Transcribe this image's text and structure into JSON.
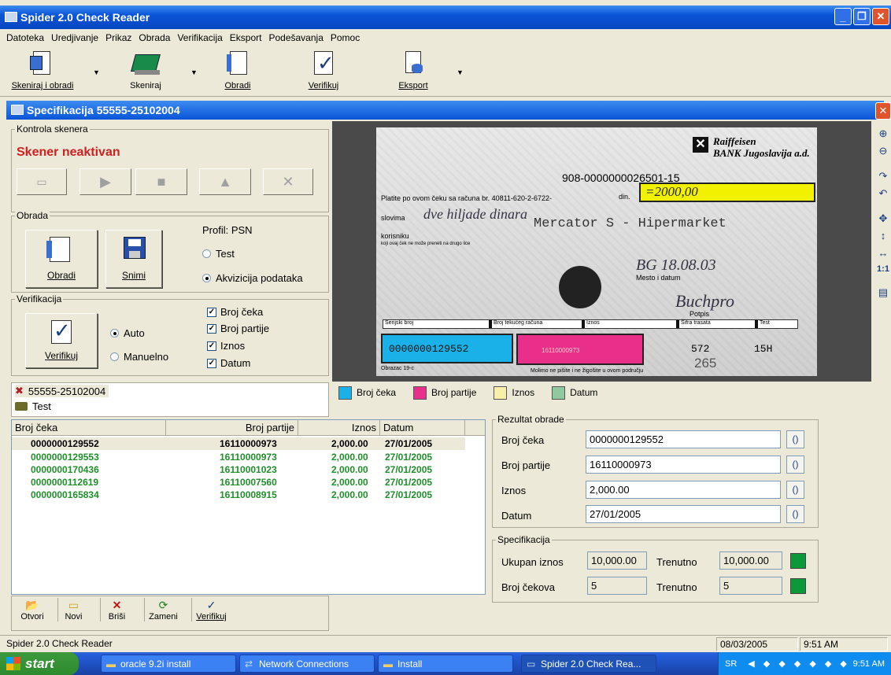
{
  "window": {
    "title": "Spider 2.0 Check Reader",
    "btn_min": "_",
    "btn_max": "❐",
    "btn_close": "✕"
  },
  "menu": [
    "Datoteka",
    "Uredjivanje",
    "Prikaz",
    "Obrada",
    "Verifikacija",
    "Eksport",
    "Podešavanja",
    "Pomoc"
  ],
  "toolbar": {
    "scan_process": "Skeniraj i obradi",
    "scan": "Skeniraj",
    "process": "Obradi",
    "verify": "Verifikuj",
    "export": "Eksport"
  },
  "doc": {
    "title": "Specifikacija 55555-25102004"
  },
  "scanner": {
    "group_label": "Kontrola skenera",
    "status": "Skener neaktivan"
  },
  "processing": {
    "group_label": "Obrada",
    "process_label": "Obradi",
    "save_label": "Snimi",
    "profile": "Profil: PSN",
    "radio_test": "Test",
    "radio_acq": "Akvizicija podataka"
  },
  "verification": {
    "group_label": "Verifikacija",
    "verify_label": "Verifikuj",
    "radio_auto": "Auto",
    "radio_manual": "Manuelno",
    "chk_check_no": "Broj čeka",
    "chk_account": "Broj partije",
    "chk_amount": "Iznos",
    "chk_date": "Datum"
  },
  "tree": {
    "root": "55555-25102004",
    "child": "Test"
  },
  "list": {
    "headers": [
      "Broj čeka",
      "Broj partije",
      "Iznos",
      "Datum"
    ],
    "rows": [
      [
        "0000000129552",
        "16110000973",
        "2,000.00",
        "27/01/2005"
      ],
      [
        "0000000129553",
        "16110000973",
        "2,000.00",
        "27/01/2005"
      ],
      [
        "0000000170436",
        "16110001023",
        "2,000.00",
        "27/01/2005"
      ],
      [
        "0000000112619",
        "16110007560",
        "2,000.00",
        "27/01/2005"
      ],
      [
        "0000000165834",
        "16110008915",
        "2,000.00",
        "27/01/2005"
      ]
    ]
  },
  "bottom_tools": {
    "open": "Otvori",
    "new": "Novi",
    "delete": "Briši",
    "replace": "Zameni",
    "verify": "Verifikuj"
  },
  "check": {
    "bank_line1": "Raiffeisen",
    "bank_line2": "BANK Jugoslavija a.d.",
    "account_no": "908-0000000026501-15",
    "pay_line": "Platite po ovom čeku sa računa br. 40811-620-2-6722-",
    "din": "din.",
    "amount_hand": "=2000,00",
    "slovima": "slovima",
    "words_hand": "dve hiljade dinara",
    "korisniku": "korisniku",
    "payee": "Mercator S - Hipermarket",
    "small_note": "koji ovaj ček ne može preneti na drugo lice",
    "date_hand": "BG 18.08.03",
    "place_date": "Mesto i datum",
    "signature": "Buchpro",
    "potpis": "Potpis",
    "boxes": [
      "Serijski broj",
      "Broj tekućeg računa",
      "Iznos",
      "Šifra trasata",
      "Test"
    ],
    "micr": "0000000129552",
    "micr_account": "16110000973",
    "code1": "572",
    "code2": "15H",
    "code3": "265",
    "form": "Obrazac 19-c",
    "bottom_note": "Molimo ne pišite i ne žigošite u ovom području"
  },
  "legend": [
    {
      "label": "Broj čeka",
      "color": "#1ab0e8"
    },
    {
      "label": "Broj partije",
      "color": "#e8308a"
    },
    {
      "label": "Iznos",
      "color": "#f8f0a8"
    },
    {
      "label": "Datum",
      "color": "#90c8a0"
    }
  ],
  "result": {
    "group_label": "Rezultat obrade",
    "check_no_label": "Broj čeka",
    "check_no": "0000000129552",
    "account_label": "Broj partije",
    "account": "16110000973",
    "amount_label": "Iznos",
    "amount": "2,000.00",
    "date_label": "Datum",
    "date": "27/01/2005",
    "btn": "()"
  },
  "spec": {
    "group_label": "Specifikacija",
    "total_label": "Ukupan iznos",
    "total": "10,000.00",
    "current_label": "Trenutno",
    "current_total": "10,000.00",
    "count_label": "Broj čekova",
    "count": "5",
    "current_count": "5"
  },
  "status": {
    "text": "Spider 2.0 Check Reader",
    "date": "08/03/2005",
    "time": "9:51 AM"
  },
  "taskbar": {
    "start": "start",
    "tasks": [
      "oracle 9.2i install",
      "Network Connections",
      "Install",
      "Spider 2.0 Check Rea..."
    ],
    "lang": "SR",
    "clock": "9:51 AM"
  }
}
